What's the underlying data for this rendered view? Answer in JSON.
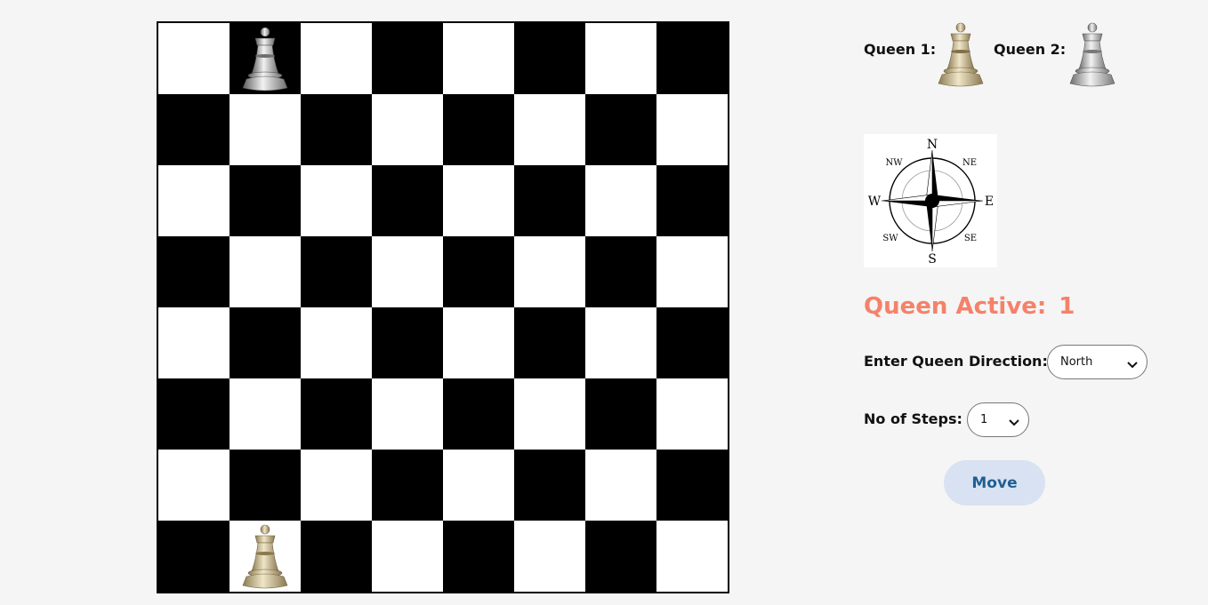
{
  "legend": {
    "queen1_label": "Queen 1:",
    "queen2_label": "Queen 2:"
  },
  "compass": {
    "n": "N",
    "s": "S",
    "e": "E",
    "w": "W",
    "ne": "NE",
    "nw": "NW",
    "se": "SE",
    "sw": "SW"
  },
  "status": {
    "active_label": "Queen Active:",
    "active_value": "1",
    "active_color": "#f4826a"
  },
  "controls": {
    "direction_label": "Enter Queen Direction:",
    "direction_value": "North",
    "steps_label": "No of Steps:",
    "steps_value": "1",
    "move_label": "Move"
  },
  "board": {
    "size": 8,
    "pieces": [
      {
        "name": "queen-2",
        "row": 0,
        "col": 1,
        "color": "silver"
      },
      {
        "name": "queen-1",
        "row": 7,
        "col": 1,
        "color": "gold"
      }
    ]
  },
  "colors": {
    "light_square": "#ffffff",
    "dark_square": "#000000",
    "gold_queen": "#c9b98f",
    "silver_queen": "#b9b9b9",
    "button_bg": "#d8e2f2",
    "button_text": "#1f5f93"
  }
}
